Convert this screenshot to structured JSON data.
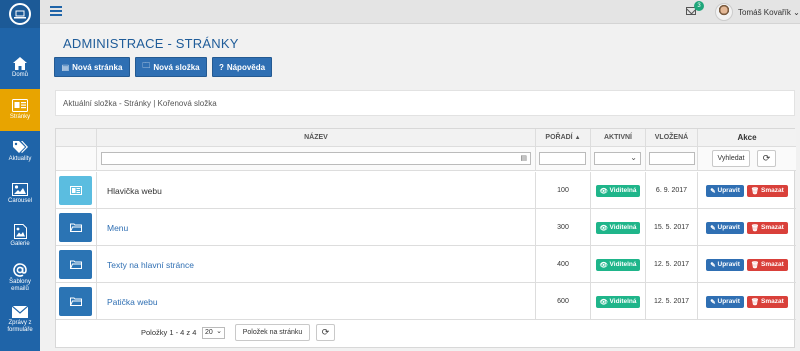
{
  "sidebar": {
    "items": [
      {
        "label": "Domů",
        "icon": "home-icon"
      },
      {
        "label": "Stránky",
        "icon": "pages-icon"
      },
      {
        "label": "Aktuality",
        "icon": "tags-icon"
      },
      {
        "label": "Carousel",
        "icon": "image-icon"
      },
      {
        "label": "Galerie",
        "icon": "gallery-icon"
      },
      {
        "label": "Šablony emailů",
        "icon": "at-icon"
      },
      {
        "label": "Zprávy z formuláře",
        "icon": "envelope-icon"
      }
    ],
    "active_index": 1
  },
  "topbar": {
    "notifications": "3",
    "user_name": "Tomáš Kovařík"
  },
  "page": {
    "title": "ADMINISTRACE - STRÁNKY"
  },
  "toolbar": {
    "new_page": "Nová stránka",
    "new_folder": "Nová složka",
    "help": "Nápověda"
  },
  "breadcrumb": "Aktuální složka - Stránky | Kořenová složka",
  "table": {
    "columns": {
      "name": "NÁZEV",
      "order": "POŘADÍ",
      "active": "AKTIVNÍ",
      "inserted": "VLOŽENÁ",
      "actions": "Akce"
    },
    "search_button": "Vyhledat",
    "active_label": "Viditelná",
    "edit_label": "Upravit",
    "delete_label": "Smazat",
    "rows": [
      {
        "name": "Hlavička webu",
        "order": "100",
        "date": "6. 9. 2017"
      },
      {
        "name": "Menu",
        "order": "300",
        "date": "15. 5. 2017"
      },
      {
        "name": "Texty na hlavní stránce",
        "order": "400",
        "date": "12. 5. 2017"
      },
      {
        "name": "Patička webu",
        "order": "600",
        "date": "12. 5. 2017"
      }
    ]
  },
  "pagination": {
    "info": "Položky 1 - 4 z 4",
    "page_size": "20",
    "per_page_button": "Položek na stránku"
  },
  "colors": {
    "sidebar": "#1f64a8",
    "active_item": "#e8a400",
    "primary": "#2f6fb3",
    "success": "#1fb58a",
    "danger": "#d9403a"
  }
}
